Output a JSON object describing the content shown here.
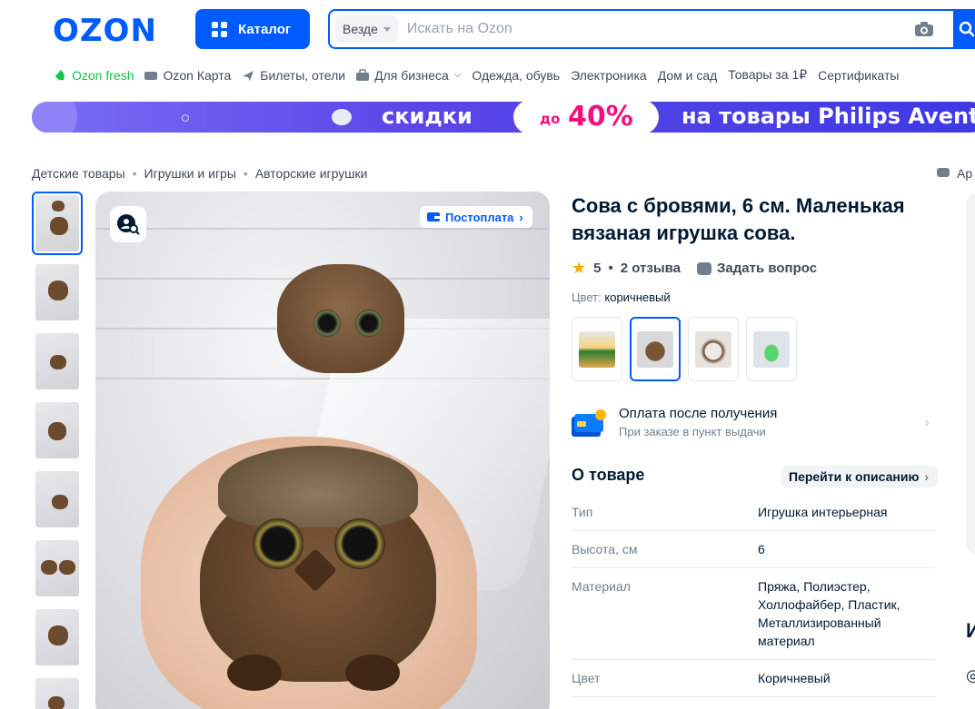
{
  "header": {
    "logo": "OZON",
    "catalog_label": "Каталог",
    "search_scope": "Везде",
    "search_placeholder": "Искать на Ozon"
  },
  "nav": {
    "items": [
      {
        "label": "Ozon fresh",
        "icon": "fresh-leaf-icon"
      },
      {
        "label": "Ozon Карта",
        "icon": "card-icon"
      },
      {
        "label": "Билеты, отели",
        "icon": "plane-icon"
      },
      {
        "label": "Для бизнеса",
        "icon": "briefcase-icon"
      },
      {
        "label": "Одежда, обувь"
      },
      {
        "label": "Электроника"
      },
      {
        "label": "Дом и сад"
      },
      {
        "label": "Товары за 1₽"
      },
      {
        "label": "Сертификаты"
      }
    ]
  },
  "banner": {
    "text1": "скидки",
    "prefix": "до",
    "percent": "40%",
    "text2": "на товары Philips Avent"
  },
  "breadcrumb": [
    "Детские товары",
    "Игрушки и игры",
    "Авторские игрушки"
  ],
  "share_label": "Ар",
  "gallery": {
    "postpay_label": "Постоплата",
    "thumb_count": 8
  },
  "product": {
    "title": "Сова с бровями, 6 см. Маленькая вязаная игрушка сова.",
    "rating": "5",
    "reviews": "2 отзыва",
    "ask_label": "Задать вопрос",
    "color_label": "Цвет:",
    "color_value": "коричневый",
    "variants": [
      {
        "name": "variant-doll"
      },
      {
        "name": "variant-owl"
      },
      {
        "name": "variant-panda"
      },
      {
        "name": "variant-lizard"
      }
    ],
    "pay_title": "Оплата после получения",
    "pay_subtitle": "При заказе в пункт выдачи",
    "about_title": "О товаре",
    "goto_label": "Перейти к описанию",
    "specs": [
      {
        "key": "Тип",
        "value": "Игрушка интерьерная"
      },
      {
        "key": "Высота, см",
        "value": "6"
      },
      {
        "key": "Материал",
        "value": "Пряжа, Полиэстер, Холлофайбер, Пластик, Металлизированный материал"
      },
      {
        "key": "Цвет",
        "value": "Коричневый"
      }
    ]
  },
  "side": {
    "glyph": "И"
  },
  "colors": {
    "brand": "#005bff",
    "fresh": "#10c44c",
    "star": "#ffa800",
    "sale": "#f1117e"
  }
}
